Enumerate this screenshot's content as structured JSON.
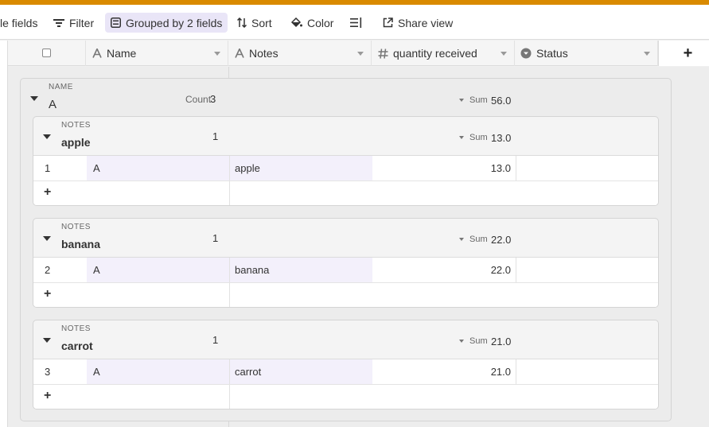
{
  "toolbar": {
    "hide_fields": "le fields",
    "filter": "Filter",
    "grouped": "Grouped by 2 fields",
    "sort": "Sort",
    "color": "Color",
    "share": "Share view"
  },
  "columns": {
    "name": "Name",
    "notes": "Notes",
    "quantity": "quantity received",
    "status": "Status",
    "add": "+"
  },
  "outer_group": {
    "field": "NAME",
    "value": "A",
    "count_label": "Count",
    "count": "3",
    "sum_label": "Sum",
    "sum": "56.0"
  },
  "groups": [
    {
      "field": "NOTES",
      "value": "apple",
      "count": "1",
      "sum_label": "Sum",
      "sum": "13.0",
      "row": {
        "index": "1",
        "name": "A",
        "notes": "apple",
        "quantity": "13.0"
      }
    },
    {
      "field": "NOTES",
      "value": "banana",
      "count": "1",
      "sum_label": "Sum",
      "sum": "22.0",
      "row": {
        "index": "2",
        "name": "A",
        "notes": "banana",
        "quantity": "22.0"
      }
    },
    {
      "field": "NOTES",
      "value": "carrot",
      "count": "1",
      "sum_label": "Sum",
      "sum": "21.0",
      "row": {
        "index": "3",
        "name": "A",
        "notes": "carrot",
        "quantity": "21.0"
      }
    }
  ],
  "add_row": "+",
  "colors": {
    "accent_bar": "#d98a00",
    "active_pill": "#e9e5f7",
    "primary_cell": "#f3f0fb"
  }
}
